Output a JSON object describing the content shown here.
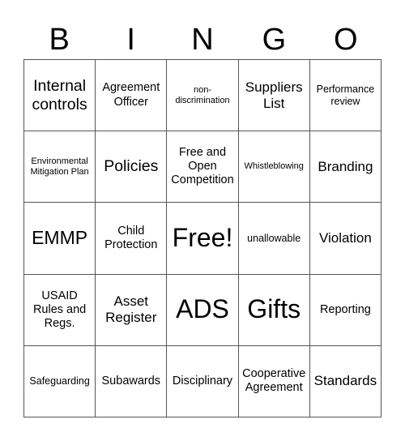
{
  "title_letters": [
    "B",
    "I",
    "N",
    "G",
    "O"
  ],
  "cells": [
    {
      "text": "Internal controls",
      "size": "s-xl"
    },
    {
      "text": "Agreement Officer",
      "size": "s-md"
    },
    {
      "text": "non-discrimination",
      "size": "s-xs"
    },
    {
      "text": "Suppliers List",
      "size": "s-lg"
    },
    {
      "text": "Performance review",
      "size": "s-sm"
    },
    {
      "text": "Environmental Mitigation Plan",
      "size": "s-xs"
    },
    {
      "text": "Policies",
      "size": "s-xl"
    },
    {
      "text": "Free and Open Competition",
      "size": "s-md"
    },
    {
      "text": "Whistleblowing",
      "size": "s-xs"
    },
    {
      "text": "Branding",
      "size": "s-lg"
    },
    {
      "text": "EMMP",
      "size": "s-xxl"
    },
    {
      "text": "Child Protection",
      "size": "s-md"
    },
    {
      "text": "Free!",
      "size": "s-huge"
    },
    {
      "text": "unallowable",
      "size": "s-sm"
    },
    {
      "text": "Violation",
      "size": "s-lg"
    },
    {
      "text": "USAID Rules and Regs.",
      "size": "s-md"
    },
    {
      "text": "Asset Register",
      "size": "s-lg"
    },
    {
      "text": "ADS",
      "size": "s-huge"
    },
    {
      "text": "Gifts",
      "size": "s-huge"
    },
    {
      "text": "Reporting",
      "size": "s-md"
    },
    {
      "text": "Safeguarding",
      "size": "s-sm"
    },
    {
      "text": "Subawards",
      "size": "s-md"
    },
    {
      "text": "Disciplinary",
      "size": "s-md"
    },
    {
      "text": "Cooperative Agreement",
      "size": "s-md"
    },
    {
      "text": "Standards",
      "size": "s-lg"
    }
  ]
}
